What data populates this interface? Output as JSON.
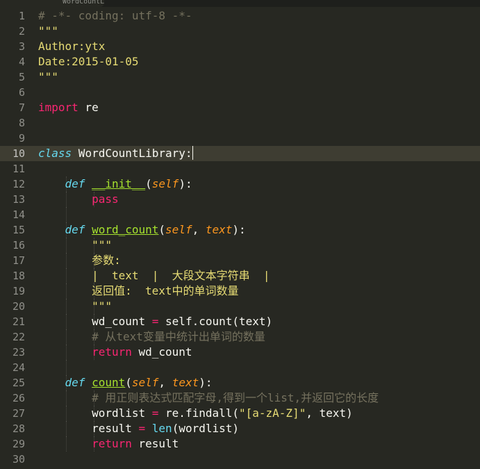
{
  "window": {
    "tab_label": "WordCountLibrary.py"
  },
  "colors": {
    "background": "#272822",
    "comment": "#75715e",
    "string": "#e6db74",
    "keyword": "#f92672",
    "storage": "#66d9ef",
    "entity": "#a6e22e",
    "parameter": "#fd971f",
    "active_line": "#3e3d32"
  },
  "editor": {
    "lines": [
      {
        "num": "1",
        "tokens": [
          {
            "t": "# -*- coding: utf-8 -*-",
            "c": "comment"
          }
        ]
      },
      {
        "num": "2",
        "tokens": [
          {
            "t": "\"\"\"",
            "c": "string"
          }
        ]
      },
      {
        "num": "3",
        "tokens": [
          {
            "t": "Author:ytx",
            "c": "string"
          }
        ]
      },
      {
        "num": "4",
        "tokens": [
          {
            "t": "Date:2015-01-05",
            "c": "string"
          }
        ]
      },
      {
        "num": "5",
        "tokens": [
          {
            "t": "\"\"\"",
            "c": "string"
          }
        ]
      },
      {
        "num": "6",
        "tokens": []
      },
      {
        "num": "7",
        "tokens": [
          {
            "t": "import",
            "c": "keyword"
          },
          {
            "t": " re",
            "c": "plain"
          }
        ]
      },
      {
        "num": "8",
        "tokens": []
      },
      {
        "num": "9",
        "tokens": []
      },
      {
        "num": "10",
        "active": true,
        "cursor": true,
        "tokens": [
          {
            "t": "class",
            "c": "storage"
          },
          {
            "t": " WordCountLibrary:",
            "c": "plain"
          }
        ]
      },
      {
        "num": "11",
        "tokens": []
      },
      {
        "num": "12",
        "indent": 1,
        "tokens": [
          {
            "t": "    ",
            "c": "plain"
          },
          {
            "t": "def",
            "c": "storage"
          },
          {
            "t": " ",
            "c": "plain"
          },
          {
            "t": "__init__",
            "c": "entity"
          },
          {
            "t": "(",
            "c": "plain"
          },
          {
            "t": "self",
            "c": "param"
          },
          {
            "t": "):",
            "c": "plain"
          }
        ]
      },
      {
        "num": "13",
        "indent": 2,
        "tokens": [
          {
            "t": "        ",
            "c": "plain"
          },
          {
            "t": "pass",
            "c": "keyword"
          }
        ]
      },
      {
        "num": "14",
        "indent": 1,
        "tokens": []
      },
      {
        "num": "15",
        "indent": 1,
        "tokens": [
          {
            "t": "    ",
            "c": "plain"
          },
          {
            "t": "def",
            "c": "storage"
          },
          {
            "t": " ",
            "c": "plain"
          },
          {
            "t": "word_count",
            "c": "entity"
          },
          {
            "t": "(",
            "c": "plain"
          },
          {
            "t": "self",
            "c": "param"
          },
          {
            "t": ", ",
            "c": "plain"
          },
          {
            "t": "text",
            "c": "param"
          },
          {
            "t": "):",
            "c": "plain"
          }
        ]
      },
      {
        "num": "16",
        "indent": 2,
        "tokens": [
          {
            "t": "        ",
            "c": "plain"
          },
          {
            "t": "\"\"\"",
            "c": "string"
          }
        ]
      },
      {
        "num": "17",
        "indent": 2,
        "tokens": [
          {
            "t": "        ",
            "c": "plain"
          },
          {
            "t": "参数:",
            "c": "string"
          }
        ]
      },
      {
        "num": "18",
        "indent": 2,
        "tokens": [
          {
            "t": "        ",
            "c": "plain"
          },
          {
            "t": "|  text  |  大段文本字符串  |",
            "c": "string"
          }
        ]
      },
      {
        "num": "19",
        "indent": 2,
        "tokens": [
          {
            "t": "        ",
            "c": "plain"
          },
          {
            "t": "返回值:  text中的单词数量",
            "c": "string"
          }
        ]
      },
      {
        "num": "20",
        "indent": 2,
        "tokens": [
          {
            "t": "        ",
            "c": "plain"
          },
          {
            "t": "\"\"\"",
            "c": "string"
          }
        ]
      },
      {
        "num": "21",
        "indent": 2,
        "tokens": [
          {
            "t": "        ",
            "c": "plain"
          },
          {
            "t": "wd_count ",
            "c": "plain"
          },
          {
            "t": "=",
            "c": "op"
          },
          {
            "t": " self.count(text)",
            "c": "plain"
          }
        ]
      },
      {
        "num": "22",
        "indent": 2,
        "tokens": [
          {
            "t": "        ",
            "c": "plain"
          },
          {
            "t": "# 从text变量中统计出单词的数量",
            "c": "comment"
          }
        ]
      },
      {
        "num": "23",
        "indent": 2,
        "tokens": [
          {
            "t": "        ",
            "c": "plain"
          },
          {
            "t": "return",
            "c": "keyword"
          },
          {
            "t": " wd_count",
            "c": "plain"
          }
        ]
      },
      {
        "num": "24",
        "indent": 1,
        "tokens": []
      },
      {
        "num": "25",
        "indent": 1,
        "tokens": [
          {
            "t": "    ",
            "c": "plain"
          },
          {
            "t": "def",
            "c": "storage"
          },
          {
            "t": " ",
            "c": "plain"
          },
          {
            "t": "count",
            "c": "entity"
          },
          {
            "t": "(",
            "c": "plain"
          },
          {
            "t": "self",
            "c": "param"
          },
          {
            "t": ", ",
            "c": "plain"
          },
          {
            "t": "text",
            "c": "param"
          },
          {
            "t": "):",
            "c": "plain"
          }
        ]
      },
      {
        "num": "26",
        "indent": 2,
        "tokens": [
          {
            "t": "        ",
            "c": "plain"
          },
          {
            "t": "# 用正则表达式匹配字母,得到一个list,并返回它的长度",
            "c": "comment"
          }
        ]
      },
      {
        "num": "27",
        "indent": 2,
        "tokens": [
          {
            "t": "        ",
            "c": "plain"
          },
          {
            "t": "wordlist ",
            "c": "plain"
          },
          {
            "t": "=",
            "c": "op"
          },
          {
            "t": " re.findall(",
            "c": "plain"
          },
          {
            "t": "\"[a-zA-Z]\"",
            "c": "string"
          },
          {
            "t": ", text)",
            "c": "plain"
          }
        ]
      },
      {
        "num": "28",
        "indent": 2,
        "tokens": [
          {
            "t": "        ",
            "c": "plain"
          },
          {
            "t": "result ",
            "c": "plain"
          },
          {
            "t": "=",
            "c": "op"
          },
          {
            "t": " ",
            "c": "plain"
          },
          {
            "t": "len",
            "c": "builtin"
          },
          {
            "t": "(wordlist)",
            "c": "plain"
          }
        ]
      },
      {
        "num": "29",
        "indent": 2,
        "tokens": [
          {
            "t": "        ",
            "c": "plain"
          },
          {
            "t": "return",
            "c": "keyword"
          },
          {
            "t": " result",
            "c": "plain"
          }
        ]
      },
      {
        "num": "30",
        "tokens": []
      }
    ]
  }
}
